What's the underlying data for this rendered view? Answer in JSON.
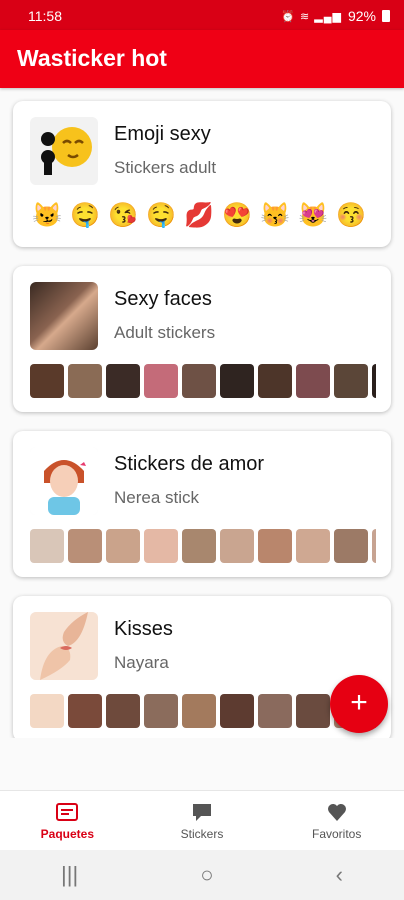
{
  "status": {
    "time": "11:58",
    "battery": "92%"
  },
  "app": {
    "title": "Wasticker hot"
  },
  "packs": [
    {
      "name": "Emoji sexy",
      "author": "Stickers adult",
      "tray_icon": "kiss-emoji-icon",
      "previews": [
        "😼",
        "🤤",
        "😘",
        "🤤",
        "💋",
        "😍",
        "😽",
        "😻",
        "😚",
        "💋"
      ]
    },
    {
      "name": "Sexy faces",
      "author": "Adult stickers",
      "tray_icon": "face-photo",
      "preview_colors": [
        "#5a3a2a",
        "#8a6b55",
        "#3b2b26",
        "#c46b79",
        "#6e5145",
        "#2f2420",
        "#4d3529",
        "#7d4b4f",
        "#5b4638",
        "#2a1f1c"
      ]
    },
    {
      "name": "Stickers de amor",
      "author": "Nerea stick",
      "tray_icon": "girl-blowing-kiss",
      "preview_colors": [
        "#d9c6b8",
        "#b98f77",
        "#caa38b",
        "#e4b8a5",
        "#a8876e",
        "#c9a590",
        "#b9866c",
        "#cfa892",
        "#9c7a66",
        "#c7a391"
      ]
    },
    {
      "name": "Kisses",
      "author": "Nayara",
      "tray_icon": "kiss-illustration",
      "preview_colors": [
        "#f3d8c4",
        "#7a4a3a",
        "#6e4a3c",
        "#8b6c5c",
        "#a37a5d",
        "#5d3b30",
        "#8a6a5d",
        "#6a4b3f",
        "#b08570",
        "#c9a08a"
      ]
    }
  ],
  "fab": {
    "label": "+"
  },
  "nav": [
    {
      "label": "Paquetes",
      "icon": "packages-icon"
    },
    {
      "label": "Stickers",
      "icon": "chat-bubble-icon"
    },
    {
      "label": "Favoritos",
      "icon": "heart-icon"
    }
  ],
  "sysnav": {
    "recents": "|||",
    "home": "○",
    "back": "‹"
  },
  "colors": {
    "accent": "#ef0015",
    "status_bar": "#d90015"
  }
}
